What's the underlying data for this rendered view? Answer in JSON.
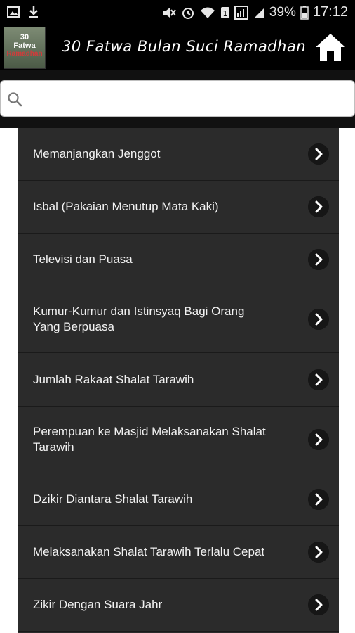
{
  "status_bar": {
    "battery": "39%",
    "time": "17:12"
  },
  "app_bar": {
    "logo_lines": [
      "30",
      "Fatwa",
      "Ramadhan"
    ],
    "title": "30 Fatwa Bulan Suci Ramadhan",
    "home_icon": "home-icon"
  },
  "search": {
    "placeholder": "",
    "value": ""
  },
  "list": {
    "items": [
      {
        "label": "Memanjangkan Jenggot"
      },
      {
        "label": "Isbal (Pakaian Menutup Mata Kaki)"
      },
      {
        "label": "Televisi dan Puasa"
      },
      {
        "label": "Kumur-Kumur dan Istinsyaq Bagi Orang Yang Berpuasa"
      },
      {
        "label": "Jumlah Rakaat Shalat Tarawih"
      },
      {
        "label": "Perempuan ke Masjid Melaksanakan Shalat Tarawih"
      },
      {
        "label": "Dzikir Diantara Shalat Tarawih"
      },
      {
        "label": "Melaksanakan Shalat Tarawih Terlalu Cepat"
      },
      {
        "label": "Zikir Dengan Suara Jahr"
      }
    ]
  },
  "colors": {
    "bar": "#000000",
    "list_bg": "#2b2b2b",
    "text": "#f2f2f2"
  }
}
